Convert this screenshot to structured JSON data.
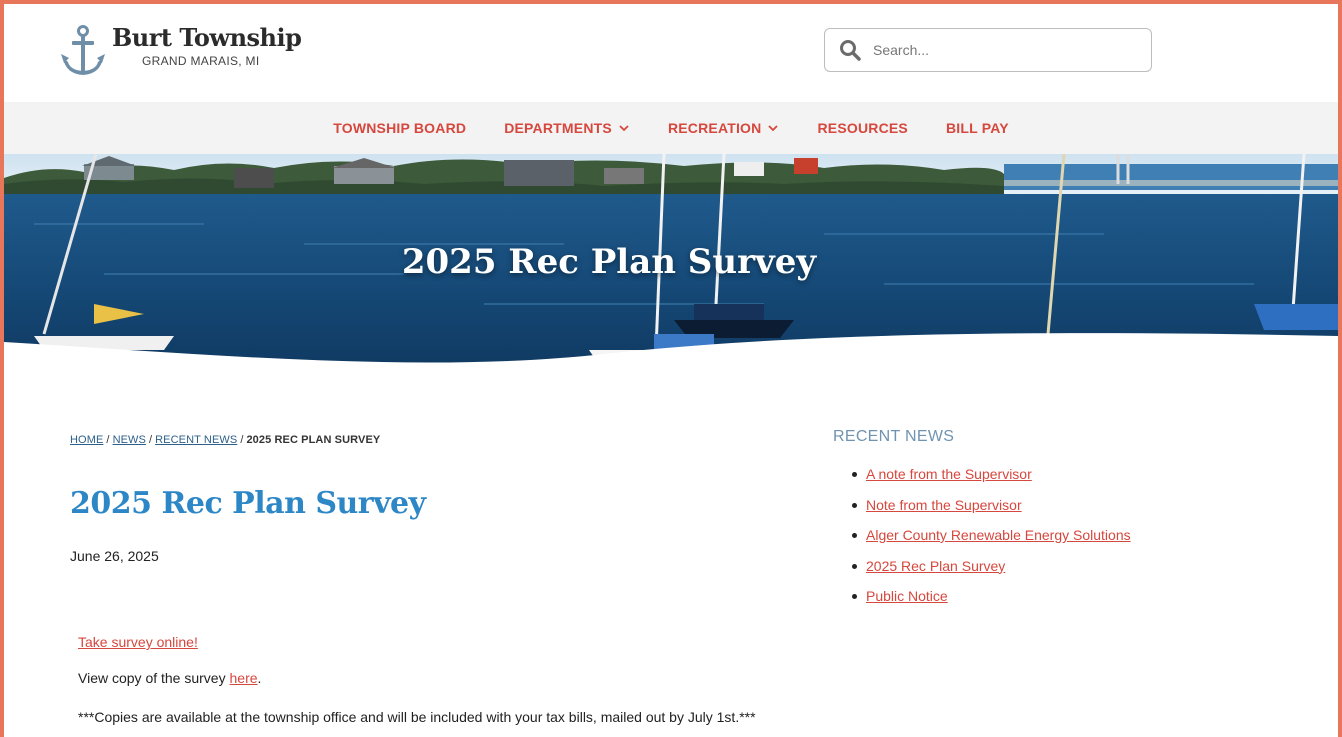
{
  "header": {
    "logo_name": "Burt Township",
    "logo_sub": "GRAND MARAIS, MI",
    "search_placeholder": "Search..."
  },
  "nav": {
    "items": [
      {
        "label": "TOWNSHIP BOARD",
        "has_dropdown": false
      },
      {
        "label": "DEPARTMENTS",
        "has_dropdown": true
      },
      {
        "label": "RECREATION",
        "has_dropdown": true
      },
      {
        "label": "RESOURCES",
        "has_dropdown": false
      },
      {
        "label": "BILL PAY",
        "has_dropdown": false
      }
    ]
  },
  "hero": {
    "title": "2025 Rec Plan Survey"
  },
  "breadcrumb": {
    "home": "HOME",
    "news": "NEWS",
    "recent_news": "RECENT NEWS",
    "sep": "/",
    "current": "2025 REC PLAN SURVEY"
  },
  "article": {
    "title": "2025 Rec Plan Survey",
    "date": "June 26, 2025",
    "survey_link": "Take survey online!",
    "view_copy_prefix": "View copy of the survey",
    "view_copy_link": "here",
    "view_copy_suffix": ".",
    "copies_note": "***Copies are available at the township office and will be included with your tax bills, mailed out by July 1st.***"
  },
  "sidebar": {
    "title": "RECENT NEWS",
    "items": [
      "A note from the Supervisor",
      "Note from the Supervisor",
      "Alger County Renewable Energy Solutions",
      "2025 Rec Plan Survey",
      "Public Notice"
    ]
  },
  "colors": {
    "accent_red": "#d6473d",
    "title_blue": "#2d87c7",
    "sidebar_title": "#6f93b0",
    "frame": "#e8765a",
    "nav_bg": "#f3f3f3"
  }
}
